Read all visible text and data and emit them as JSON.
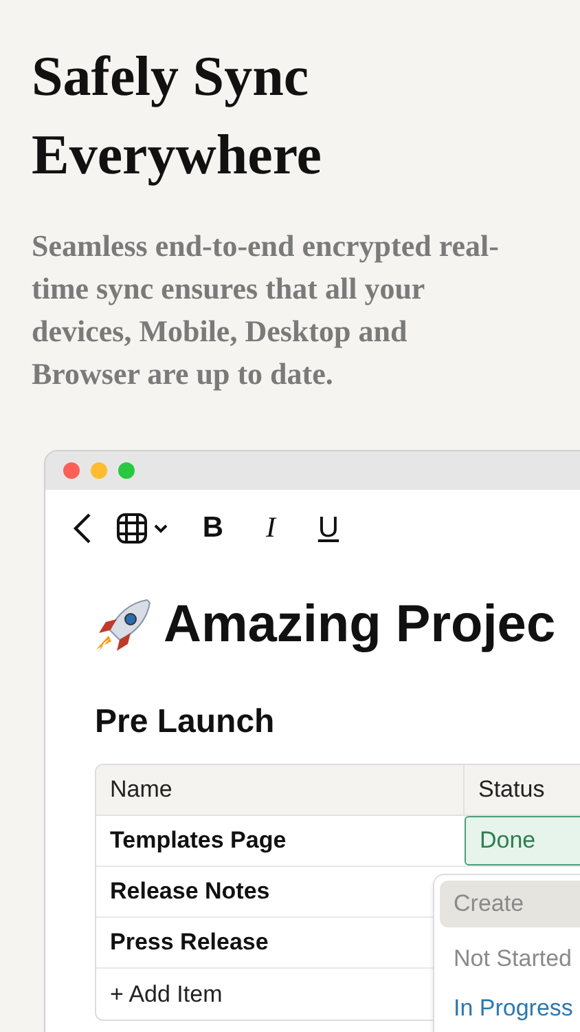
{
  "headline": "Safely Sync Everywhere",
  "subtitle": "Seamless end-to-end encrypted real-time sync ensures that all your devices, Mobile, Desktop and Browser are up to date.",
  "toolbar": {
    "buttons": [
      {
        "kind": "back"
      },
      {
        "kind": "table"
      },
      {
        "kind": "text",
        "label": "B"
      },
      {
        "kind": "text",
        "label": "I"
      },
      {
        "kind": "text",
        "label": "U"
      }
    ]
  },
  "document": {
    "title": "Amazing Projec",
    "section": "Pre Launch",
    "table": {
      "columns": [
        "Name",
        "Status"
      ],
      "rows": [
        {
          "name": "Templates Page",
          "status": "Done",
          "color": "#2e7d4f",
          "editing": true
        },
        {
          "name": "Release Notes"
        },
        {
          "name": "Press Release"
        }
      ],
      "add_item": "+ Add Item"
    }
  },
  "dropdown": {
    "items": [
      {
        "kind": "create",
        "label": "Create",
        "selected": true
      },
      {
        "kind": "option",
        "label": "Not Started",
        "color": "#8a8a8a",
        "selected": false
      },
      {
        "kind": "option",
        "label": "In Progress",
        "color": "#2c78b0",
        "selected": false
      }
    ]
  }
}
